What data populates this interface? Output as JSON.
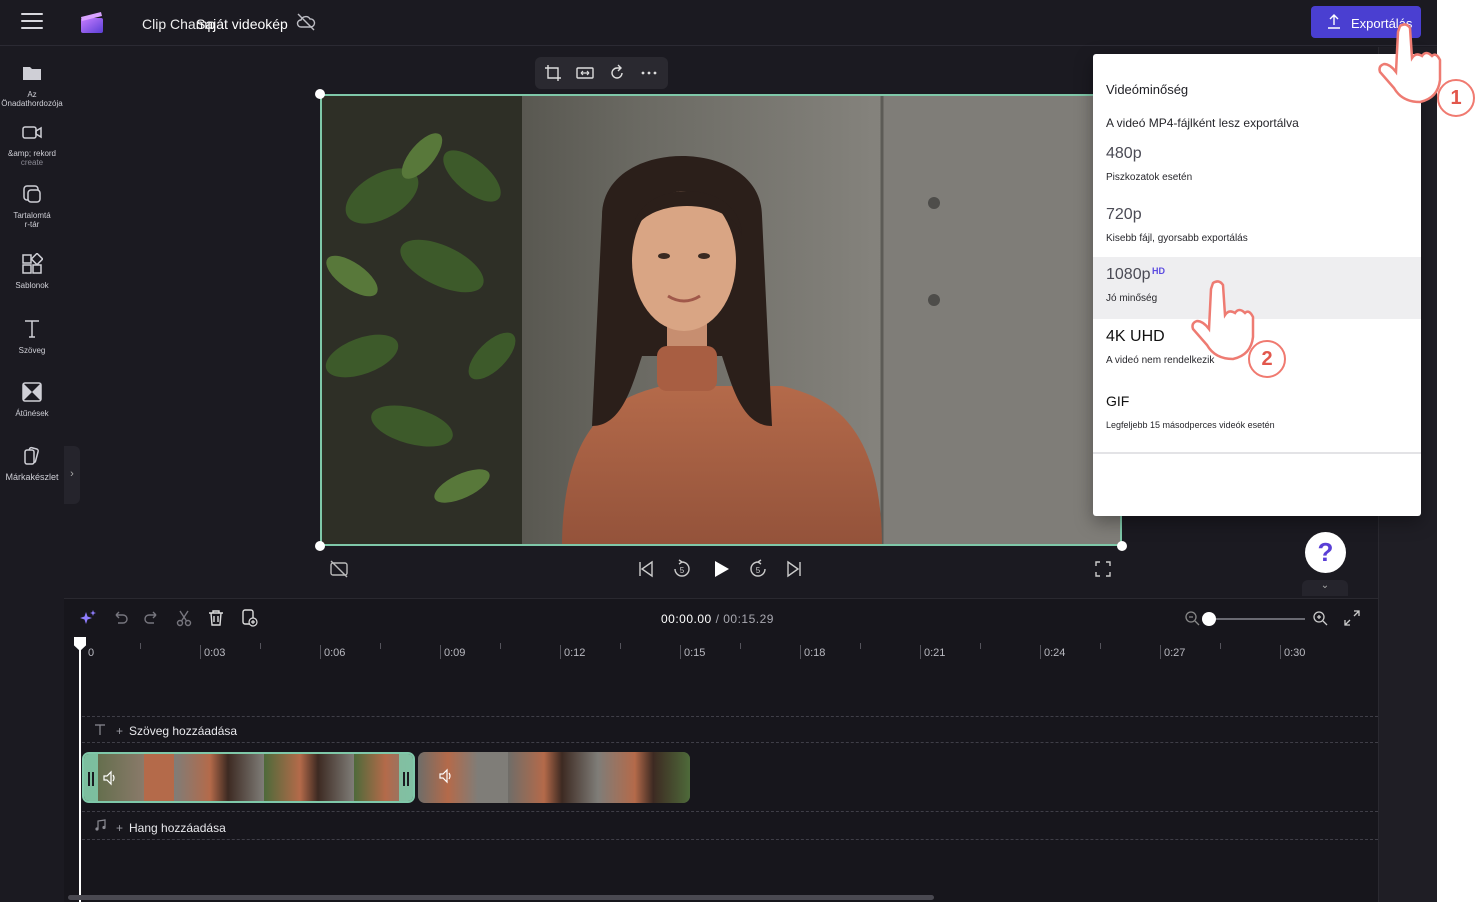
{
  "header": {
    "app_name": "Clip Champ",
    "project_name": "Saját videokép",
    "export_label": "Exportálás"
  },
  "sidebar": {
    "items": [
      {
        "label": "Az Önadathordozója",
        "sub": "",
        "icon": "folder-icon"
      },
      {
        "label": "&amp; rekord",
        "sub": "create",
        "icon": "camera-icon"
      },
      {
        "label": "Tartalomtá",
        "sub": "r-tár",
        "icon": "content-library-icon"
      },
      {
        "label": "Sablonok",
        "sub": "",
        "icon": "templates-icon"
      },
      {
        "label": "Szöveg",
        "sub": "",
        "icon": "text-icon"
      },
      {
        "label": "Átűnések",
        "sub": "",
        "icon": "transitions-icon"
      },
      {
        "label": "Márkakészlet",
        "sub": "",
        "icon": "brand-kit-icon"
      }
    ]
  },
  "export_menu": {
    "title": "Videóminőség",
    "subtitle": "A videó MP4-fájlként lesz exportálva",
    "options": [
      {
        "resolution": "480p",
        "description": "Piszkozatok esetén",
        "badge": ""
      },
      {
        "resolution": "720p",
        "description": "Kisebb fájl, gyorsabb exportálás",
        "badge": ""
      },
      {
        "resolution": "1080p",
        "description": "Jó minőség",
        "badge": "HD"
      },
      {
        "resolution": "4K UHD",
        "description": "A videó nem rendelkezik",
        "badge": ""
      },
      {
        "resolution": "GIF",
        "description": "Legfeljebb 15 másodperces videók esetén",
        "badge": ""
      }
    ]
  },
  "help": {
    "label": "?"
  },
  "timeline": {
    "current_time": "00:00.00",
    "total_time": "/ 00:15.29",
    "ticks": [
      "0",
      "0:03",
      "0:06",
      "0:09",
      "0:12",
      "0:15",
      "0:18",
      "0:21",
      "0:24",
      "0:27",
      "0:30"
    ],
    "text_track_label": "Szöveg hozzáadása",
    "audio_track_label": "Hang hozzáadása"
  },
  "annotations": {
    "step1": "1",
    "step2": "2"
  },
  "colors": {
    "accent": "#4a3fd1",
    "selection": "#7fc8a9",
    "callout": "#e2574c"
  }
}
